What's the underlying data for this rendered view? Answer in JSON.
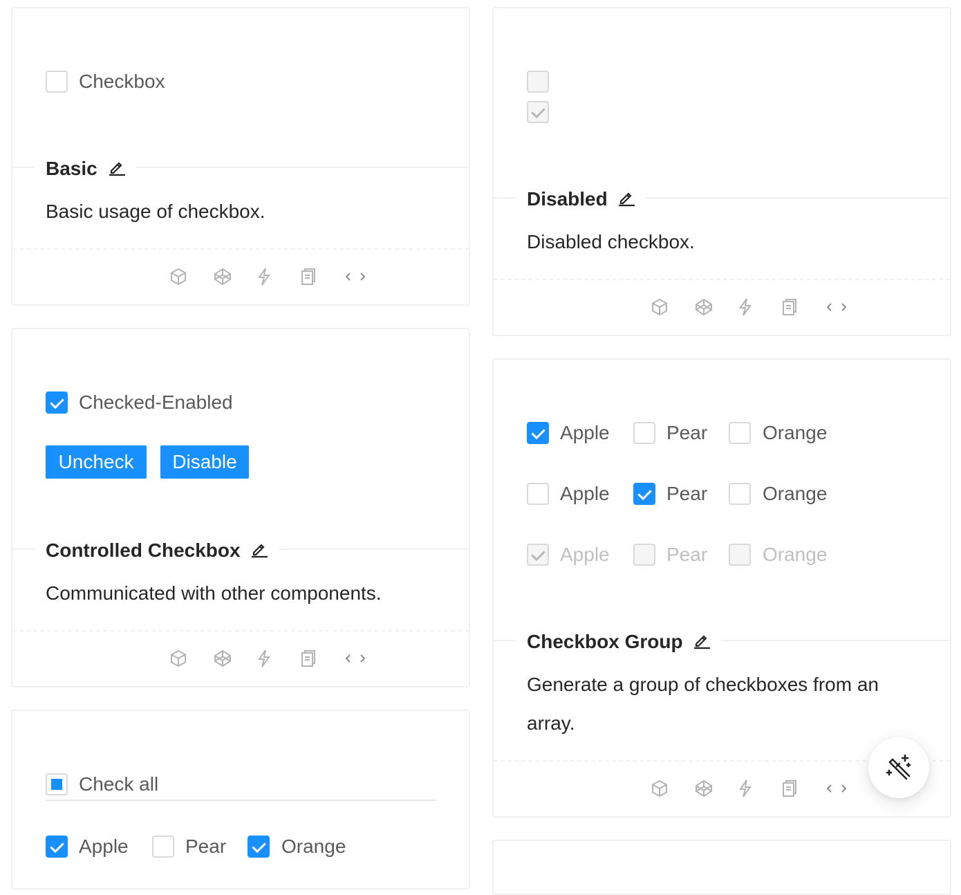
{
  "basic": {
    "checkbox_label": "Checkbox",
    "title": "Basic",
    "description": "Basic usage of checkbox."
  },
  "disabled": {
    "title": "Disabled",
    "description": "Disabled checkbox."
  },
  "controlled": {
    "checkbox_label": "Checked-Enabled",
    "uncheck_label": "Uncheck",
    "disable_label": "Disable",
    "title": "Controlled Checkbox",
    "description": "Communicated with other components."
  },
  "group": {
    "rows": [
      [
        {
          "label": "Apple",
          "checked": true
        },
        {
          "label": "Pear",
          "checked": false
        },
        {
          "label": "Orange",
          "checked": false
        }
      ],
      [
        {
          "label": "Apple",
          "checked": false
        },
        {
          "label": "Pear",
          "checked": true
        },
        {
          "label": "Orange",
          "checked": false
        }
      ],
      [
        {
          "label": "Apple",
          "checked": true,
          "disabled": true
        },
        {
          "label": "Pear",
          "checked": false,
          "disabled": true
        },
        {
          "label": "Orange",
          "checked": false,
          "disabled": true
        }
      ]
    ],
    "title": "Checkbox Group",
    "description_line1": "Generate a group of checkboxes from an",
    "description_line2": "array."
  },
  "check_all": {
    "label": "Check all",
    "options": [
      {
        "label": "Apple",
        "checked": true
      },
      {
        "label": "Pear",
        "checked": false
      },
      {
        "label": "Orange",
        "checked": true
      }
    ]
  },
  "action_icons": [
    "codesandbox-icon",
    "codepen-icon",
    "riddle-icon",
    "copy-icon",
    "code-icon"
  ],
  "colors": {
    "primary": "#1890ff",
    "border": "#d9d9d9",
    "divider": "#f0f0f0"
  }
}
